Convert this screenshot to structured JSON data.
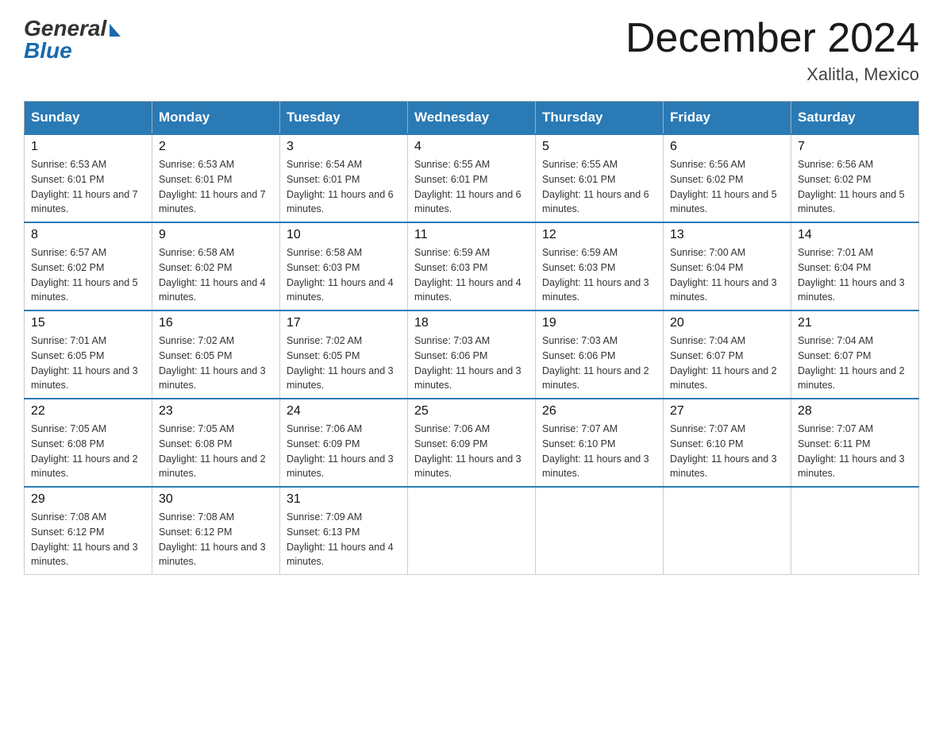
{
  "logo": {
    "general": "General",
    "blue": "Blue"
  },
  "title": "December 2024",
  "location": "Xalitla, Mexico",
  "days_of_week": [
    "Sunday",
    "Monday",
    "Tuesday",
    "Wednesday",
    "Thursday",
    "Friday",
    "Saturday"
  ],
  "weeks": [
    [
      {
        "day": "1",
        "sunrise": "6:53 AM",
        "sunset": "6:01 PM",
        "daylight": "11 hours and 7 minutes."
      },
      {
        "day": "2",
        "sunrise": "6:53 AM",
        "sunset": "6:01 PM",
        "daylight": "11 hours and 7 minutes."
      },
      {
        "day": "3",
        "sunrise": "6:54 AM",
        "sunset": "6:01 PM",
        "daylight": "11 hours and 6 minutes."
      },
      {
        "day": "4",
        "sunrise": "6:55 AM",
        "sunset": "6:01 PM",
        "daylight": "11 hours and 6 minutes."
      },
      {
        "day": "5",
        "sunrise": "6:55 AM",
        "sunset": "6:01 PM",
        "daylight": "11 hours and 6 minutes."
      },
      {
        "day": "6",
        "sunrise": "6:56 AM",
        "sunset": "6:02 PM",
        "daylight": "11 hours and 5 minutes."
      },
      {
        "day": "7",
        "sunrise": "6:56 AM",
        "sunset": "6:02 PM",
        "daylight": "11 hours and 5 minutes."
      }
    ],
    [
      {
        "day": "8",
        "sunrise": "6:57 AM",
        "sunset": "6:02 PM",
        "daylight": "11 hours and 5 minutes."
      },
      {
        "day": "9",
        "sunrise": "6:58 AM",
        "sunset": "6:02 PM",
        "daylight": "11 hours and 4 minutes."
      },
      {
        "day": "10",
        "sunrise": "6:58 AM",
        "sunset": "6:03 PM",
        "daylight": "11 hours and 4 minutes."
      },
      {
        "day": "11",
        "sunrise": "6:59 AM",
        "sunset": "6:03 PM",
        "daylight": "11 hours and 4 minutes."
      },
      {
        "day": "12",
        "sunrise": "6:59 AM",
        "sunset": "6:03 PM",
        "daylight": "11 hours and 3 minutes."
      },
      {
        "day": "13",
        "sunrise": "7:00 AM",
        "sunset": "6:04 PM",
        "daylight": "11 hours and 3 minutes."
      },
      {
        "day": "14",
        "sunrise": "7:01 AM",
        "sunset": "6:04 PM",
        "daylight": "11 hours and 3 minutes."
      }
    ],
    [
      {
        "day": "15",
        "sunrise": "7:01 AM",
        "sunset": "6:05 PM",
        "daylight": "11 hours and 3 minutes."
      },
      {
        "day": "16",
        "sunrise": "7:02 AM",
        "sunset": "6:05 PM",
        "daylight": "11 hours and 3 minutes."
      },
      {
        "day": "17",
        "sunrise": "7:02 AM",
        "sunset": "6:05 PM",
        "daylight": "11 hours and 3 minutes."
      },
      {
        "day": "18",
        "sunrise": "7:03 AM",
        "sunset": "6:06 PM",
        "daylight": "11 hours and 3 minutes."
      },
      {
        "day": "19",
        "sunrise": "7:03 AM",
        "sunset": "6:06 PM",
        "daylight": "11 hours and 2 minutes."
      },
      {
        "day": "20",
        "sunrise": "7:04 AM",
        "sunset": "6:07 PM",
        "daylight": "11 hours and 2 minutes."
      },
      {
        "day": "21",
        "sunrise": "7:04 AM",
        "sunset": "6:07 PM",
        "daylight": "11 hours and 2 minutes."
      }
    ],
    [
      {
        "day": "22",
        "sunrise": "7:05 AM",
        "sunset": "6:08 PM",
        "daylight": "11 hours and 2 minutes."
      },
      {
        "day": "23",
        "sunrise": "7:05 AM",
        "sunset": "6:08 PM",
        "daylight": "11 hours and 2 minutes."
      },
      {
        "day": "24",
        "sunrise": "7:06 AM",
        "sunset": "6:09 PM",
        "daylight": "11 hours and 3 minutes."
      },
      {
        "day": "25",
        "sunrise": "7:06 AM",
        "sunset": "6:09 PM",
        "daylight": "11 hours and 3 minutes."
      },
      {
        "day": "26",
        "sunrise": "7:07 AM",
        "sunset": "6:10 PM",
        "daylight": "11 hours and 3 minutes."
      },
      {
        "day": "27",
        "sunrise": "7:07 AM",
        "sunset": "6:10 PM",
        "daylight": "11 hours and 3 minutes."
      },
      {
        "day": "28",
        "sunrise": "7:07 AM",
        "sunset": "6:11 PM",
        "daylight": "11 hours and 3 minutes."
      }
    ],
    [
      {
        "day": "29",
        "sunrise": "7:08 AM",
        "sunset": "6:12 PM",
        "daylight": "11 hours and 3 minutes."
      },
      {
        "day": "30",
        "sunrise": "7:08 AM",
        "sunset": "6:12 PM",
        "daylight": "11 hours and 3 minutes."
      },
      {
        "day": "31",
        "sunrise": "7:09 AM",
        "sunset": "6:13 PM",
        "daylight": "11 hours and 4 minutes."
      },
      null,
      null,
      null,
      null
    ]
  ]
}
